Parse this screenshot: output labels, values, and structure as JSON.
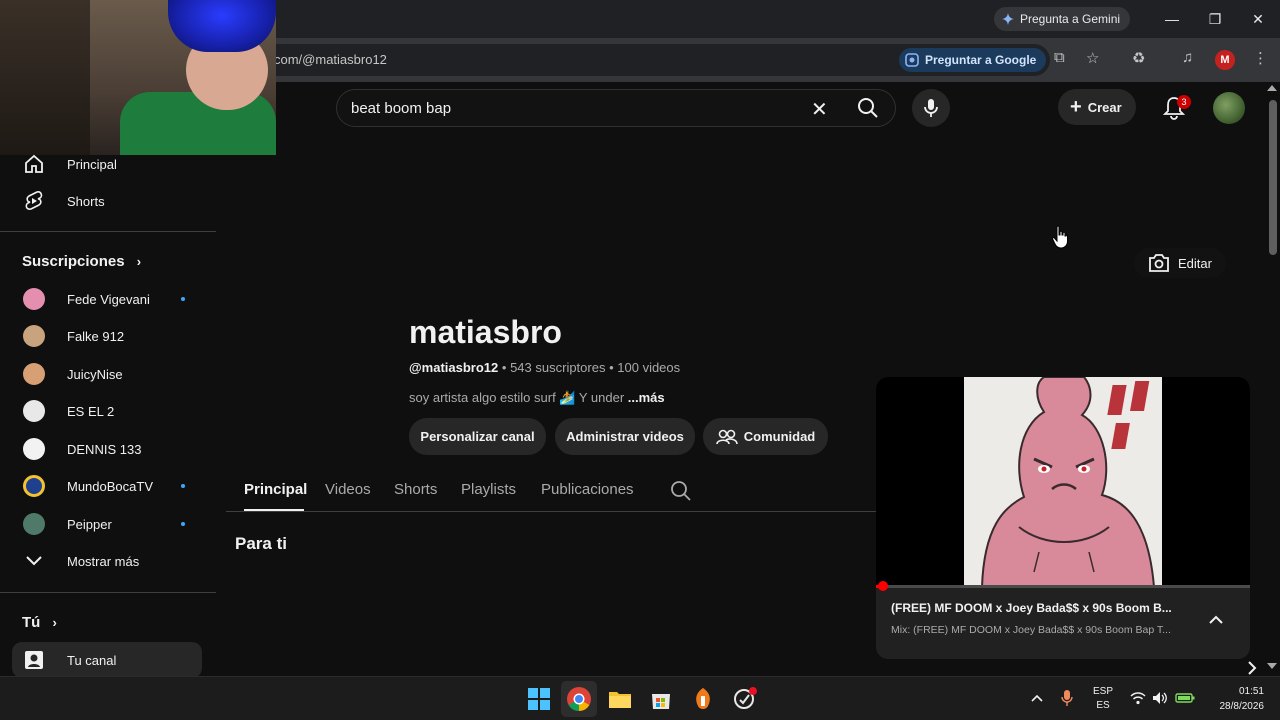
{
  "browser": {
    "gemini_label": "Pregunta a Gemini",
    "url": "com/@matiasbro12",
    "ask_google_label": "Preguntar a Google",
    "profile_initial": "M"
  },
  "header": {
    "search_value": "beat boom bap",
    "create_label": "Crear",
    "notification_count": "3"
  },
  "sidebar": {
    "nav": [
      {
        "label": "Principal"
      },
      {
        "label": "Shorts"
      }
    ],
    "subscriptions_heading": "Suscripciones",
    "subscriptions": [
      {
        "label": "Fede Vigevani",
        "new": true,
        "color": "#e58fb0"
      },
      {
        "label": "Falke 912",
        "new": false,
        "color": "#c9a27e"
      },
      {
        "label": "JuicyNise",
        "new": false,
        "color": "#d6a074"
      },
      {
        "label": "ES EL 2",
        "new": false,
        "color": "#e8e8e8"
      },
      {
        "label": "DENNIS 133",
        "new": false,
        "color": "#f2f2f2"
      },
      {
        "label": "MundoBocaTV",
        "new": true,
        "color": "#1f3f8f"
      },
      {
        "label": "Peipper",
        "new": true,
        "color": "#4f7a6a"
      }
    ],
    "show_more_label": "Mostrar más",
    "you_heading": "Tú",
    "your_channel_label": "Tu canal"
  },
  "channel": {
    "name": "matiasbro",
    "handle": "@matiasbro12",
    "subscribers": "543 suscriptores",
    "videos": "100 videos",
    "description": "soy artista algo estilo surf 🏄 Y under",
    "more_label": "...más",
    "edit_label": "Editar",
    "actions": [
      {
        "label": "Personalizar canal"
      },
      {
        "label": "Administrar videos"
      },
      {
        "label": "Comunidad"
      }
    ],
    "tabs": [
      "Principal",
      "Videos",
      "Shorts",
      "Playlists",
      "Publicaciones"
    ],
    "section_title": "Para ti"
  },
  "miniplayer": {
    "title": "(FREE) MF DOOM x Joey Bada$$ x 90s Boom B...",
    "subtitle": "Mix: (FREE) MF DOOM x Joey Bada$$ x 90s Boom Bap T...",
    "progress_fraction": 0.02
  },
  "taskbar": {
    "lang_top": "ESP",
    "lang_bottom": "ES",
    "time": "01:51",
    "date": "28/8/2026"
  },
  "colors": {
    "accent_red": "#ff0000",
    "link_blue": "#3ea6ff"
  }
}
